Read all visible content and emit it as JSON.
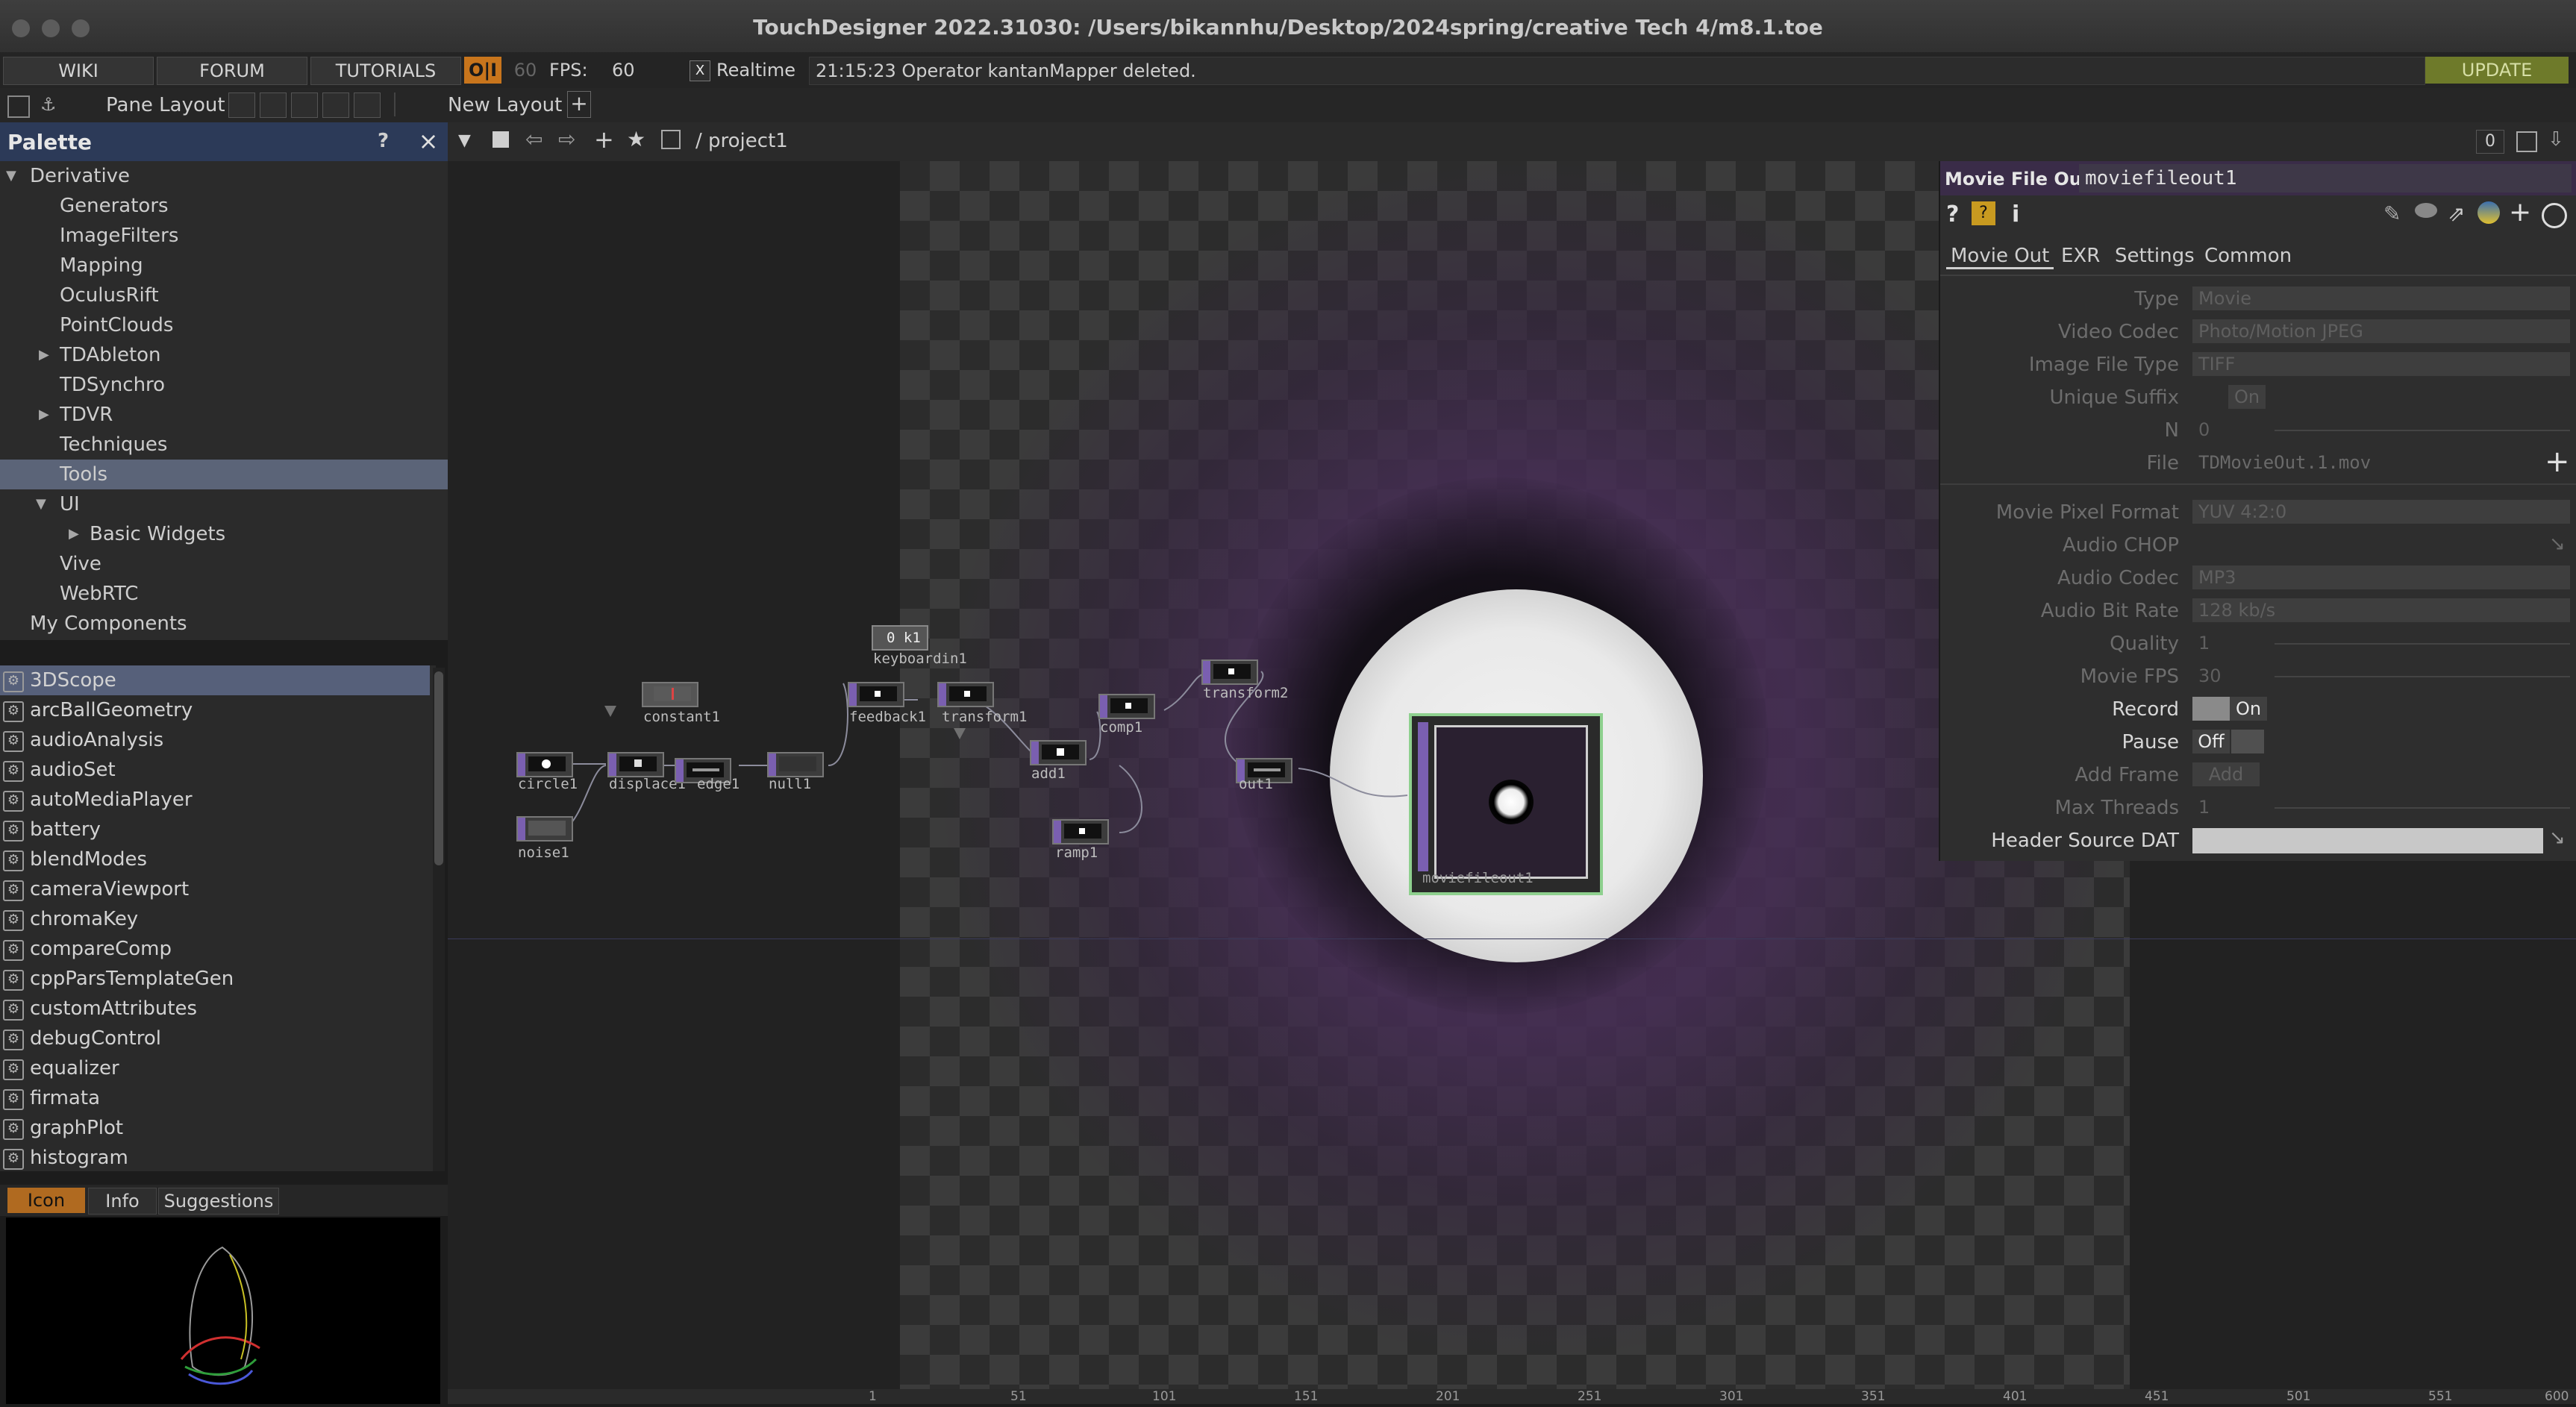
{
  "window": {
    "title": "TouchDesigner 2022.31030: /Users/bikannhu/Desktop/2024spring/creative Tech 4/m8.1.toe"
  },
  "menubar": {
    "wiki": "WIKI",
    "forum": "FORUM",
    "tutorials": "TUTORIALS",
    "oi": "O|I",
    "fps_target": "60",
    "fps_label": "FPS:",
    "fps_value": "60",
    "realtime_check": "X",
    "realtime_label": "Realtime",
    "status_message": "21:15:23 Operator kantanMapper deleted.",
    "update": "UPDATE"
  },
  "toolbar": {
    "pane_layout": "Pane Layout",
    "new_layout": "New Layout",
    "add": "+"
  },
  "palette": {
    "title": "Palette",
    "help": "?",
    "close": "×",
    "tree": [
      {
        "label": "Derivative"
      },
      {
        "label": "Generators"
      },
      {
        "label": "ImageFilters"
      },
      {
        "label": "Mapping"
      },
      {
        "label": "OculusRift"
      },
      {
        "label": "PointClouds"
      },
      {
        "label": "TDAbleton"
      },
      {
        "label": "TDSynchro"
      },
      {
        "label": "TDVR"
      },
      {
        "label": "Techniques"
      },
      {
        "label": "Tools"
      },
      {
        "label": "UI"
      },
      {
        "label": "Basic Widgets"
      },
      {
        "label": "Vive"
      },
      {
        "label": "WebRTC"
      },
      {
        "label": "My Components"
      }
    ],
    "components": [
      "3DScope",
      "arcBallGeometry",
      "audioAnalysis",
      "audioSet",
      "autoMediaPlayer",
      "battery",
      "blendModes",
      "cameraViewport",
      "chromaKey",
      "compareComp",
      "cppParsTemplateGen",
      "customAttributes",
      "debugControl",
      "equalizer",
      "firmata",
      "graphPlot",
      "histogram"
    ],
    "bottom_tabs": {
      "icon": "Icon",
      "info": "Info",
      "suggestions": "Suggestions"
    }
  },
  "network": {
    "path": "/ project1",
    "right_counter": "0",
    "nodes": {
      "circle1": "circle1",
      "noise1": "noise1",
      "displace1": "displace1",
      "edge1": "edge1",
      "constant1": "constant1",
      "null1": "null1",
      "keyboardin1": "keyboardin1",
      "keyboard_value": "0 k1",
      "feedback1": "feedback1",
      "transform1": "transform1",
      "add1": "add1",
      "comp1": "comp1",
      "transform2": "transform2",
      "ramp1": "ramp1",
      "out1": "out1",
      "moviefileout1": "moviefileout1"
    }
  },
  "params": {
    "op_type": "Movie File Out",
    "op_name": "moviefileout1",
    "tabs": [
      "Movie Out",
      "EXR",
      "Settings",
      "Common"
    ],
    "type_label": "Type",
    "type_value": "Movie",
    "video_codec_label": "Video Codec",
    "video_codec_value": "Photo/Motion JPEG",
    "image_file_type_label": "Image File Type",
    "image_file_type_value": "TIFF",
    "unique_suffix_label": "Unique Suffix",
    "unique_suffix_value": "On",
    "n_label": "N",
    "n_value": "0",
    "file_label": "File",
    "file_value": "TDMovieOut.1.mov",
    "movie_pixel_format_label": "Movie Pixel Format",
    "movie_pixel_format_value": "YUV 4:2:0",
    "audio_chop_label": "Audio CHOP",
    "audio_codec_label": "Audio Codec",
    "audio_codec_value": "MP3",
    "audio_bit_rate_label": "Audio Bit Rate",
    "audio_bit_rate_value": "128 kb/s",
    "quality_label": "Quality",
    "quality_value": "1",
    "movie_fps_label": "Movie FPS",
    "movie_fps_value": "30",
    "record_label": "Record",
    "record_value": "On",
    "pause_label": "Pause",
    "pause_value": "Off",
    "add_frame_label": "Add Frame",
    "add_frame_value": "Add",
    "max_threads_label": "Max Threads",
    "max_threads_value": "1",
    "header_source_dat_label": "Header Source DAT"
  },
  "timeline": {
    "ticks": [
      "1",
      "51",
      "101",
      "151",
      "201",
      "251",
      "301",
      "351",
      "401",
      "451",
      "501",
      "551",
      "600"
    ]
  }
}
